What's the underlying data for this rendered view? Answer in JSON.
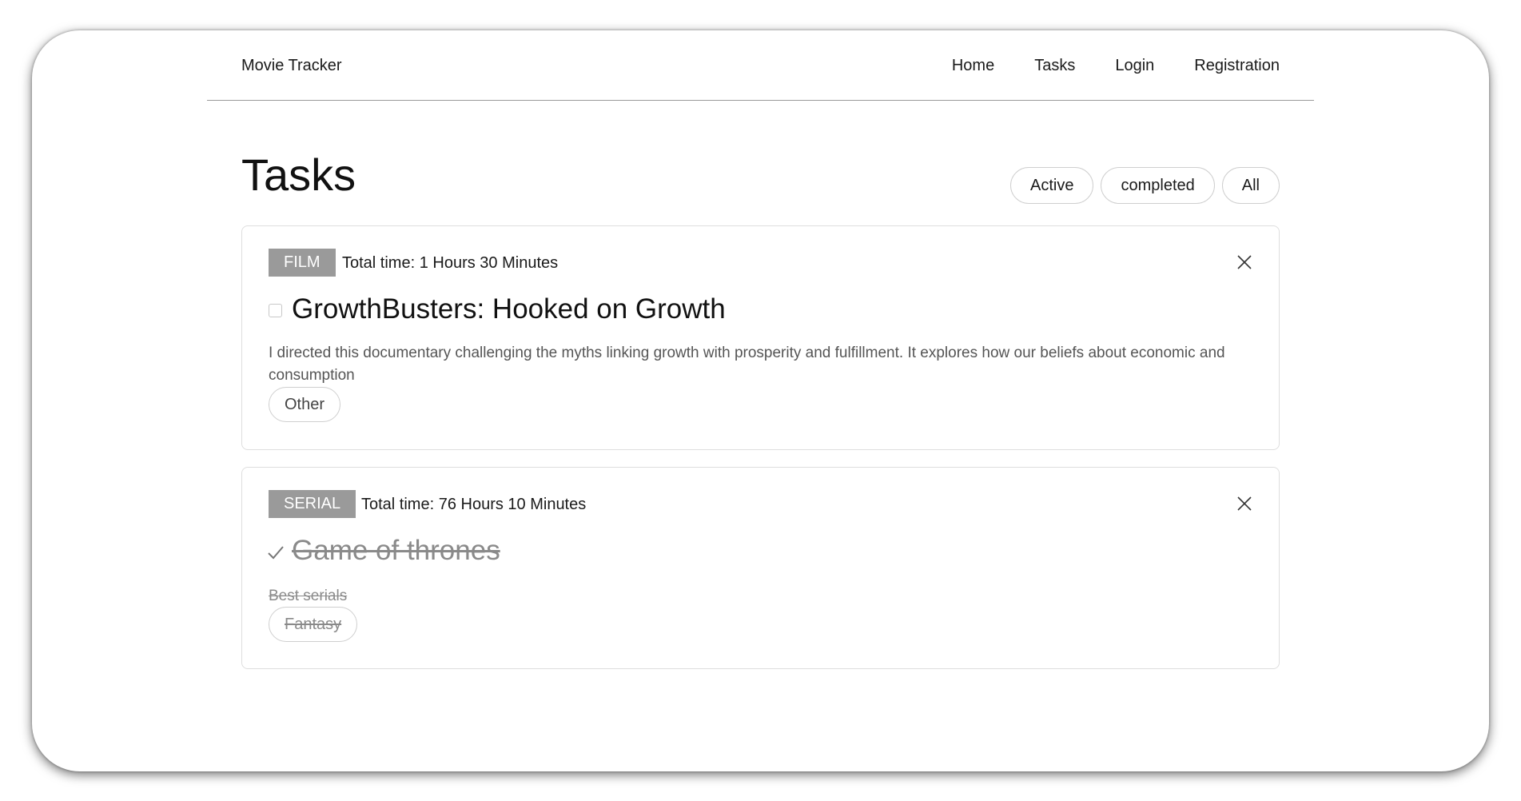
{
  "header": {
    "brand": "Movie Tracker",
    "nav": [
      "Home",
      "Tasks",
      "Login",
      "Registration"
    ]
  },
  "page": {
    "title": "Tasks",
    "filters": [
      "Active",
      "completed",
      "All"
    ]
  },
  "tasks": [
    {
      "type": "FILM",
      "total_time": "Total time: 1 Hours 30 Minutes",
      "completed": false,
      "title": "GrowthBusters: Hooked on Growth",
      "description": "I directed this documentary challenging the myths linking growth with prosperity and fulfillment. It explores how our beliefs about economic and consumption",
      "genre": "Other"
    },
    {
      "type": "SERIAL",
      "total_time": "Total time: 76 Hours 10 Minutes",
      "completed": true,
      "title": "Game of thrones",
      "description": "Best serials",
      "genre": "Fantasy"
    }
  ],
  "icons": {
    "close": "close-icon",
    "check": "check-icon"
  },
  "colors": {
    "badge_bg": "#9a9a9a",
    "completed_text": "#8a8a8a",
    "border": "#dedede"
  }
}
